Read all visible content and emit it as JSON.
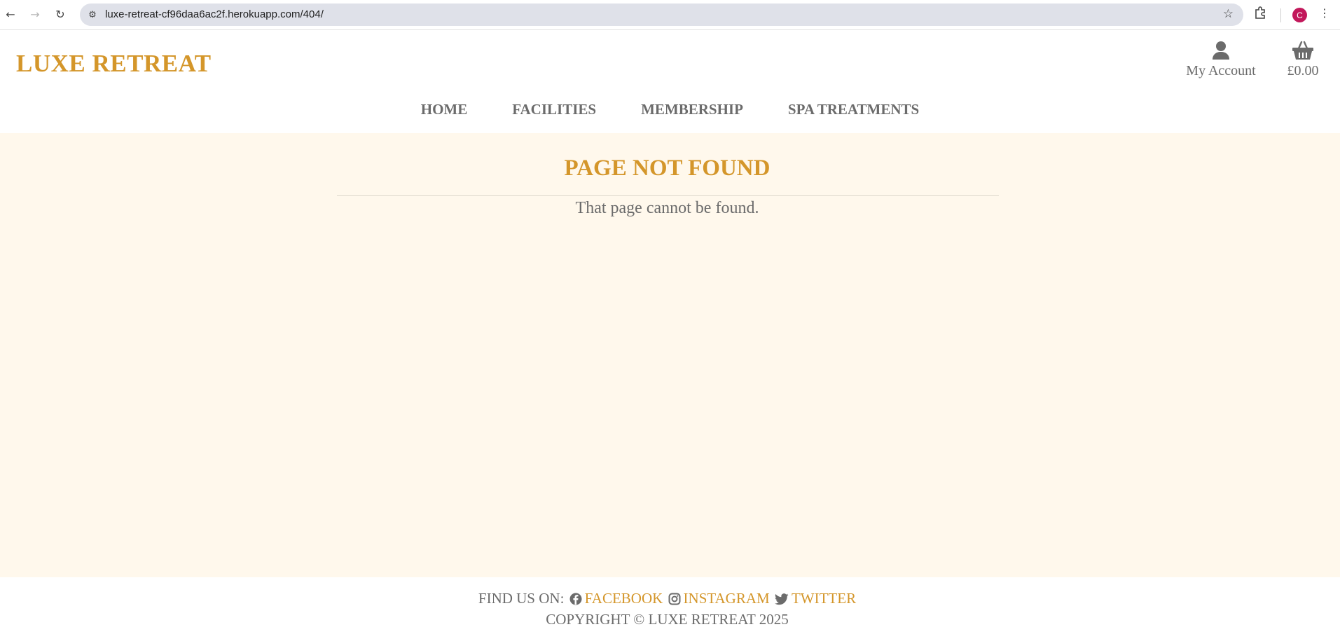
{
  "browser": {
    "url": "luxe-retreat-cf96daa6ac2f.herokuapp.com/404/",
    "profile_initial": "C",
    "icons": [
      "back-icon",
      "forward-icon",
      "reload-icon",
      "site-info-icon",
      "star-icon",
      "extensions-icon",
      "menu-icon"
    ]
  },
  "header": {
    "logo": "LUXE RETREAT",
    "account_label": "My Account",
    "cart_total": "£0.00",
    "nav": [
      {
        "label": "HOME"
      },
      {
        "label": "FACILITIES"
      },
      {
        "label": "MEMBERSHIP"
      },
      {
        "label": "SPA TREATMENTS"
      }
    ]
  },
  "main": {
    "title": "PAGE NOT FOUND",
    "message": "That page cannot be found."
  },
  "footer": {
    "find_us_label": "FIND US ON:",
    "facebook": "FACEBOOK",
    "instagram": "INSTAGRAM",
    "twitter": "TWITTER",
    "copyright": "COPYRIGHT © LUXE RETREAT 2025"
  },
  "colors": {
    "accent": "#d4962a",
    "text": "#6b6b6b",
    "main_bg": "#fff8ec",
    "profile": "#c2185b"
  }
}
